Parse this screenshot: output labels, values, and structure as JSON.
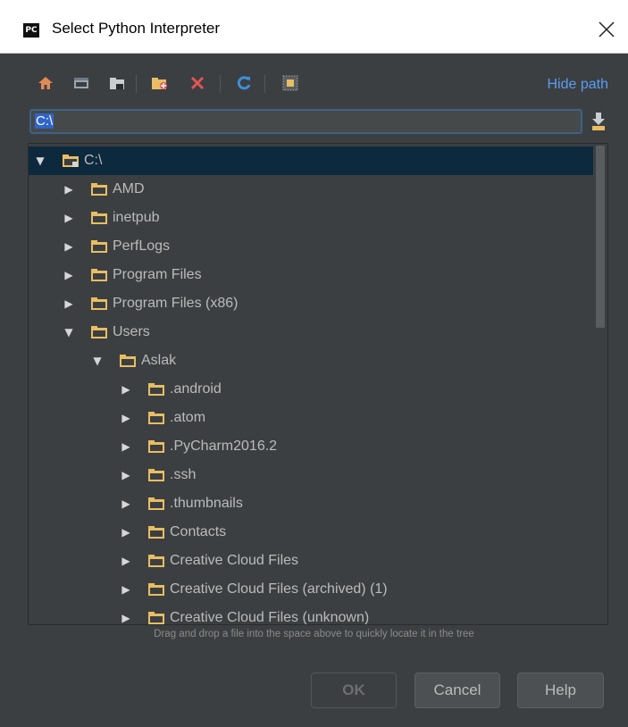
{
  "window": {
    "app_badge": "PC",
    "title": "Select Python Interpreter",
    "close_glyph": "✕"
  },
  "toolbar": {
    "icons": [
      "home-icon",
      "desktop-icon",
      "project-folder-icon",
      "new-folder-icon",
      "delete-icon",
      "refresh-icon",
      "show-hidden-icon"
    ],
    "hide_path_label": "Hide path"
  },
  "path_field": {
    "value": "C:\\"
  },
  "tree": {
    "items": [
      {
        "label": "C:\\",
        "depth": 0,
        "expanded": true,
        "selected": true,
        "drive": true
      },
      {
        "label": "AMD",
        "depth": 1,
        "expanded": false
      },
      {
        "label": "inetpub",
        "depth": 1,
        "expanded": false
      },
      {
        "label": "PerfLogs",
        "depth": 1,
        "expanded": false
      },
      {
        "label": "Program Files",
        "depth": 1,
        "expanded": false
      },
      {
        "label": "Program Files (x86)",
        "depth": 1,
        "expanded": false
      },
      {
        "label": "Users",
        "depth": 1,
        "expanded": true
      },
      {
        "label": "Aslak",
        "depth": 2,
        "expanded": true
      },
      {
        "label": ".android",
        "depth": 3,
        "expanded": false
      },
      {
        "label": ".atom",
        "depth": 3,
        "expanded": false
      },
      {
        "label": ".PyCharm2016.2",
        "depth": 3,
        "expanded": false
      },
      {
        "label": ".ssh",
        "depth": 3,
        "expanded": false
      },
      {
        "label": ".thumbnails",
        "depth": 3,
        "expanded": false
      },
      {
        "label": "Contacts",
        "depth": 3,
        "expanded": false
      },
      {
        "label": "Creative Cloud Files",
        "depth": 3,
        "expanded": false
      },
      {
        "label": "Creative Cloud Files (archived) (1)",
        "depth": 3,
        "expanded": false
      },
      {
        "label": "Creative Cloud Files (unknown)",
        "depth": 3,
        "expanded": false
      }
    ],
    "hint": "Drag and drop a file into the space above to quickly locate it in the tree"
  },
  "buttons": {
    "ok": "OK",
    "cancel": "Cancel",
    "help": "Help"
  },
  "colors": {
    "background": "#3c3f41",
    "selection": "#0d293e",
    "link": "#589df6",
    "folder": "#e8bd63"
  }
}
